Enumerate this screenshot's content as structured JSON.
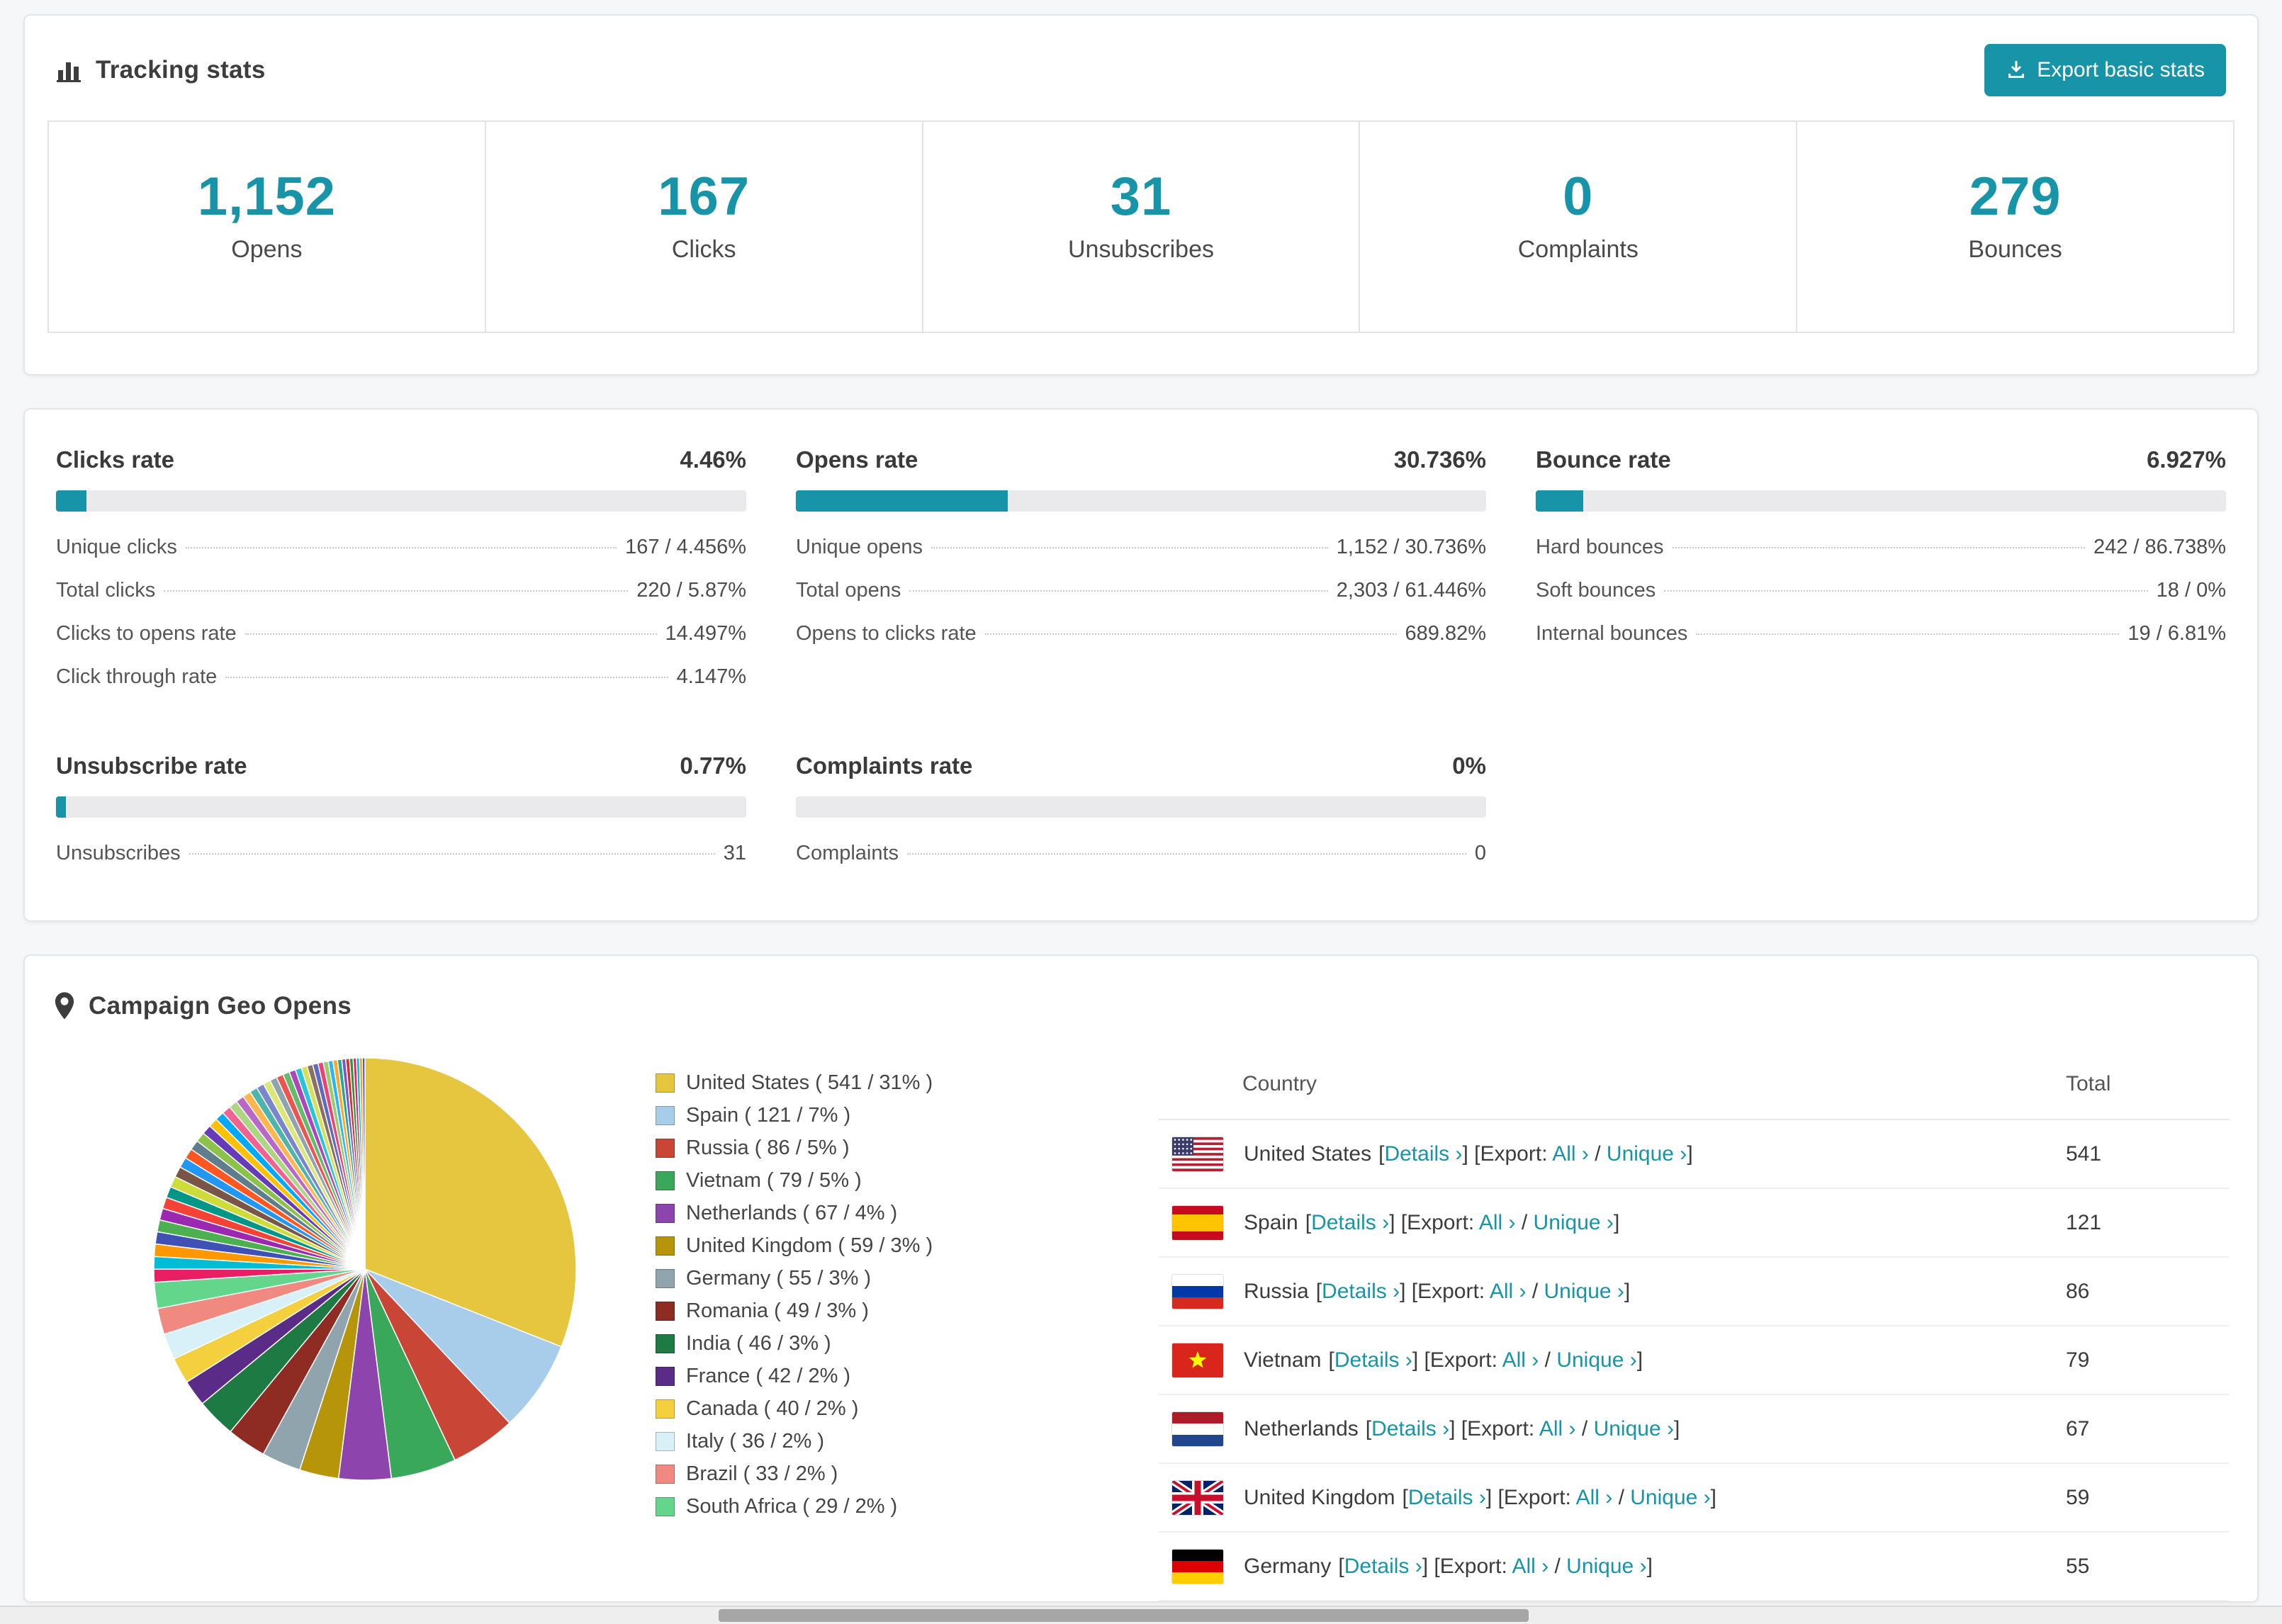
{
  "theme": {
    "accent": "#1794a8",
    "track": "#eaeaec"
  },
  "tracking": {
    "title": "Tracking stats",
    "export_label": "Export basic stats",
    "stats": [
      {
        "value": "1,152",
        "label": "Opens"
      },
      {
        "value": "167",
        "label": "Clicks"
      },
      {
        "value": "31",
        "label": "Unsubscribes"
      },
      {
        "value": "0",
        "label": "Complaints"
      },
      {
        "value": "279",
        "label": "Bounces"
      }
    ]
  },
  "rates": [
    {
      "title": "Clicks rate",
      "value": "4.46%",
      "percent": 4.46,
      "rows": [
        {
          "label": "Unique clicks",
          "value": "167 / 4.456%"
        },
        {
          "label": "Total clicks",
          "value": "220 / 5.87%"
        },
        {
          "label": "Clicks to opens rate",
          "value": "14.497%"
        },
        {
          "label": "Click through rate",
          "value": "4.147%"
        }
      ]
    },
    {
      "title": "Opens rate",
      "value": "30.736%",
      "percent": 30.736,
      "rows": [
        {
          "label": "Unique opens",
          "value": "1,152 / 30.736%"
        },
        {
          "label": "Total opens",
          "value": "2,303 / 61.446%"
        },
        {
          "label": "Opens to clicks rate",
          "value": "689.82%"
        }
      ]
    },
    {
      "title": "Bounce rate",
      "value": "6.927%",
      "percent": 6.927,
      "rows": [
        {
          "label": "Hard bounces",
          "value": "242 / 86.738%"
        },
        {
          "label": "Soft bounces",
          "value": "18 / 0%"
        },
        {
          "label": "Internal bounces",
          "value": "19 / 6.81%"
        }
      ]
    },
    {
      "title": "Unsubscribe rate",
      "value": "0.77%",
      "percent": 0.77,
      "rows": [
        {
          "label": "Unsubscribes",
          "value": "31"
        }
      ]
    },
    {
      "title": "Complaints rate",
      "value": "0%",
      "percent": 0,
      "rows": [
        {
          "label": "Complaints",
          "value": "0"
        }
      ]
    }
  ],
  "geo": {
    "title": "Campaign Geo Opens",
    "table": {
      "country_header": "Country",
      "total_header": "Total",
      "tokens": {
        "open_bracket": "[",
        "close_bracket": "]",
        "details": "Details",
        "export": "Export:",
        "all": "All",
        "unique": "Unique",
        "chevron": "›",
        "slash": "/"
      },
      "rows": [
        {
          "country": "United States",
          "flag": "us",
          "total": "541"
        },
        {
          "country": "Spain",
          "flag": "es",
          "total": "121"
        },
        {
          "country": "Russia",
          "flag": "ru",
          "total": "86"
        },
        {
          "country": "Vietnam",
          "flag": "vn",
          "total": "79"
        },
        {
          "country": "Netherlands",
          "flag": "nl",
          "total": "67"
        },
        {
          "country": "United Kingdom",
          "flag": "gb",
          "total": "59"
        },
        {
          "country": "Germany",
          "flag": "de",
          "total": "55"
        }
      ]
    }
  },
  "chart_data": {
    "type": "pie",
    "title": "Campaign Geo Opens",
    "legend_position": "right",
    "slices": [
      {
        "label": "United States",
        "value": 541,
        "pct": 31,
        "color": "#e6c53f"
      },
      {
        "label": "Spain",
        "value": 121,
        "pct": 7,
        "color": "#a8cdea"
      },
      {
        "label": "Russia",
        "value": 86,
        "pct": 5,
        "color": "#c94637"
      },
      {
        "label": "Vietnam",
        "value": 79,
        "pct": 5,
        "color": "#39a85b"
      },
      {
        "label": "Netherlands",
        "value": 67,
        "pct": 4,
        "color": "#8e44ad"
      },
      {
        "label": "United Kingdom",
        "value": 59,
        "pct": 3,
        "color": "#b7950b"
      },
      {
        "label": "Germany",
        "value": 55,
        "pct": 3,
        "color": "#90a4ae"
      },
      {
        "label": "Romania",
        "value": 49,
        "pct": 3,
        "color": "#8e2b23"
      },
      {
        "label": "India",
        "value": 46,
        "pct": 3,
        "color": "#1e7a43"
      },
      {
        "label": "France",
        "value": 42,
        "pct": 2,
        "color": "#5b2c87"
      },
      {
        "label": "Canada",
        "value": 40,
        "pct": 2,
        "color": "#f4d03f"
      },
      {
        "label": "Italy",
        "value": 36,
        "pct": 2,
        "color": "#d8f0f8"
      },
      {
        "label": "Brazil",
        "value": 33,
        "pct": 2,
        "color": "#f08a80"
      },
      {
        "label": "South Africa",
        "value": 29,
        "pct": 2,
        "color": "#63d68b"
      }
    ],
    "others": {
      "pct": 26,
      "count": 44,
      "palette": [
        "#e91e63",
        "#00bcd4",
        "#ff9800",
        "#3f51b5",
        "#4caf50",
        "#9c27b0",
        "#f44336",
        "#009688",
        "#cddc39",
        "#795548",
        "#2196f3",
        "#ff5722",
        "#607d8b",
        "#8bc34a",
        "#673ab7",
        "#ffc107",
        "#03a9f4",
        "#f06292",
        "#aed581",
        "#ba68c8",
        "#ffb74d",
        "#4db6ac",
        "#7986cb",
        "#dce775",
        "#90a4ae",
        "#ef5350",
        "#66bb6a",
        "#ab47bc",
        "#26c6da",
        "#d4e157",
        "#8d6e63",
        "#5c6bc0",
        "#ec407a",
        "#9ccc65",
        "#29b6f6",
        "#ffa726",
        "#26a69a",
        "#7e57c2",
        "#d32f2f",
        "#388e3c"
      ]
    }
  }
}
